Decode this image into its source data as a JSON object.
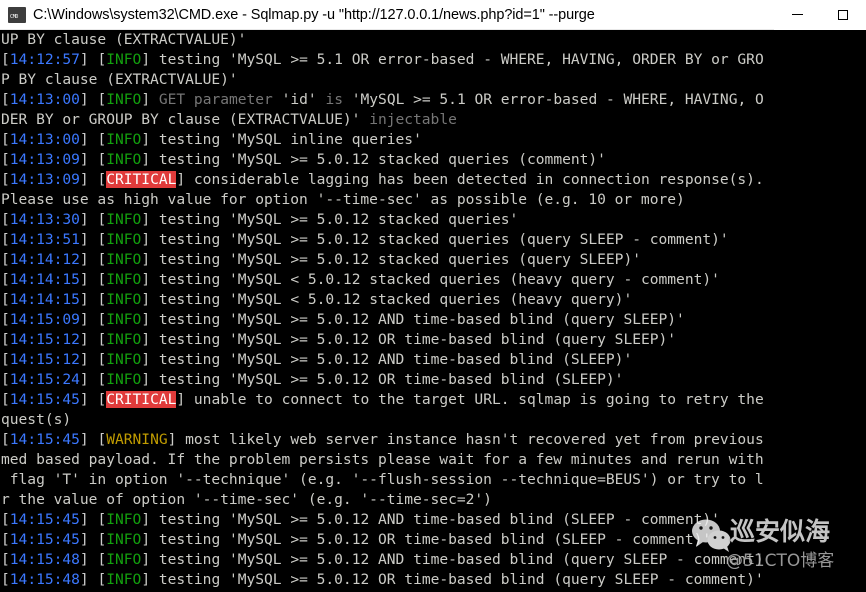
{
  "window": {
    "title": "C:\\Windows\\system32\\CMD.exe - Sqlmap.py  -u \"http://127.0.0.1/news.php?id=1\" --purge",
    "icon_label": "CMD",
    "minimize_label": "—",
    "maximize_label": "☐"
  },
  "colors": {
    "background": "#000000",
    "titlebar_background": "#ffffff",
    "default_text": "#c8d0d8",
    "timestamp": "#3b78ff",
    "info": "#13a10e",
    "warning": "#c19c00",
    "critical_background": "#e03b3b",
    "critical_text": "#ffffff",
    "dim_text": "#767676"
  },
  "console": {
    "lines": [
      {
        "segments": [
          {
            "text": "UP BY clause (EXTRACTVALUE)'",
            "style": "txt"
          }
        ]
      },
      {
        "segments": [
          {
            "text": "[",
            "style": "brk"
          },
          {
            "text": "14:12:57",
            "style": "time"
          },
          {
            "text": "] [",
            "style": "brk"
          },
          {
            "text": "INFO",
            "style": "info"
          },
          {
            "text": "] testing 'MySQL >= 5.1 OR error-based - WHERE, HAVING, ORDER BY or GRO",
            "style": "txt"
          }
        ]
      },
      {
        "segments": [
          {
            "text": "P BY clause (EXTRACTVALUE)'",
            "style": "txt"
          }
        ]
      },
      {
        "segments": [
          {
            "text": "[",
            "style": "brk"
          },
          {
            "text": "14:13:00",
            "style": "time"
          },
          {
            "text": "] [",
            "style": "brk"
          },
          {
            "text": "INFO",
            "style": "info"
          },
          {
            "text": "] ",
            "style": "txt"
          },
          {
            "text": "GET parameter",
            "style": "dim"
          },
          {
            "text": " 'id' ",
            "style": "txt"
          },
          {
            "text": "is",
            "style": "dim"
          },
          {
            "text": " 'MySQL >= 5.1 OR error-based - WHERE, HAVING, O",
            "style": "txt"
          }
        ]
      },
      {
        "segments": [
          {
            "text": "DER BY or GROUP BY clause (EXTRACTVALUE)' ",
            "style": "txt"
          },
          {
            "text": "injectable",
            "style": "dim"
          }
        ]
      },
      {
        "segments": [
          {
            "text": "[",
            "style": "brk"
          },
          {
            "text": "14:13:00",
            "style": "time"
          },
          {
            "text": "] [",
            "style": "brk"
          },
          {
            "text": "INFO",
            "style": "info"
          },
          {
            "text": "] testing 'MySQL inline queries'",
            "style": "txt"
          }
        ]
      },
      {
        "segments": [
          {
            "text": "[",
            "style": "brk"
          },
          {
            "text": "14:13:09",
            "style": "time"
          },
          {
            "text": "] [",
            "style": "brk"
          },
          {
            "text": "INFO",
            "style": "info"
          },
          {
            "text": "] testing 'MySQL >= 5.0.12 stacked queries (comment)'",
            "style": "txt"
          }
        ]
      },
      {
        "segments": [
          {
            "text": "[",
            "style": "brk"
          },
          {
            "text": "14:13:09",
            "style": "time"
          },
          {
            "text": "] [",
            "style": "brk"
          },
          {
            "text": "CRITICAL",
            "style": "crit"
          },
          {
            "text": "] considerable lagging has been detected in connection response(s).",
            "style": "txt"
          }
        ]
      },
      {
        "segments": [
          {
            "text": "Please use as high value for option '--time-sec' as possible (e.g. 10 or more)",
            "style": "txt"
          }
        ]
      },
      {
        "segments": [
          {
            "text": "[",
            "style": "brk"
          },
          {
            "text": "14:13:30",
            "style": "time"
          },
          {
            "text": "] [",
            "style": "brk"
          },
          {
            "text": "INFO",
            "style": "info"
          },
          {
            "text": "] testing 'MySQL >= 5.0.12 stacked queries'",
            "style": "txt"
          }
        ]
      },
      {
        "segments": [
          {
            "text": "[",
            "style": "brk"
          },
          {
            "text": "14:13:51",
            "style": "time"
          },
          {
            "text": "] [",
            "style": "brk"
          },
          {
            "text": "INFO",
            "style": "info"
          },
          {
            "text": "] testing 'MySQL >= 5.0.12 stacked queries (query SLEEP - comment)'",
            "style": "txt"
          }
        ]
      },
      {
        "segments": [
          {
            "text": "[",
            "style": "brk"
          },
          {
            "text": "14:14:12",
            "style": "time"
          },
          {
            "text": "] [",
            "style": "brk"
          },
          {
            "text": "INFO",
            "style": "info"
          },
          {
            "text": "] testing 'MySQL >= 5.0.12 stacked queries (query SLEEP)'",
            "style": "txt"
          }
        ]
      },
      {
        "segments": [
          {
            "text": "[",
            "style": "brk"
          },
          {
            "text": "14:14:15",
            "style": "time"
          },
          {
            "text": "] [",
            "style": "brk"
          },
          {
            "text": "INFO",
            "style": "info"
          },
          {
            "text": "] testing 'MySQL < 5.0.12 stacked queries (heavy query - comment)'",
            "style": "txt"
          }
        ]
      },
      {
        "segments": [
          {
            "text": "[",
            "style": "brk"
          },
          {
            "text": "14:14:15",
            "style": "time"
          },
          {
            "text": "] [",
            "style": "brk"
          },
          {
            "text": "INFO",
            "style": "info"
          },
          {
            "text": "] testing 'MySQL < 5.0.12 stacked queries (heavy query)'",
            "style": "txt"
          }
        ]
      },
      {
        "segments": [
          {
            "text": "[",
            "style": "brk"
          },
          {
            "text": "14:15:09",
            "style": "time"
          },
          {
            "text": "] [",
            "style": "brk"
          },
          {
            "text": "INFO",
            "style": "info"
          },
          {
            "text": "] testing 'MySQL >= 5.0.12 AND time-based blind (query SLEEP)'",
            "style": "txt"
          }
        ]
      },
      {
        "segments": [
          {
            "text": "[",
            "style": "brk"
          },
          {
            "text": "14:15:12",
            "style": "time"
          },
          {
            "text": "] [",
            "style": "brk"
          },
          {
            "text": "INFO",
            "style": "info"
          },
          {
            "text": "] testing 'MySQL >= 5.0.12 OR time-based blind (query SLEEP)'",
            "style": "txt"
          }
        ]
      },
      {
        "segments": [
          {
            "text": "[",
            "style": "brk"
          },
          {
            "text": "14:15:12",
            "style": "time"
          },
          {
            "text": "] [",
            "style": "brk"
          },
          {
            "text": "INFO",
            "style": "info"
          },
          {
            "text": "] testing 'MySQL >= 5.0.12 AND time-based blind (SLEEP)'",
            "style": "txt"
          }
        ]
      },
      {
        "segments": [
          {
            "text": "[",
            "style": "brk"
          },
          {
            "text": "14:15:24",
            "style": "time"
          },
          {
            "text": "] [",
            "style": "brk"
          },
          {
            "text": "INFO",
            "style": "info"
          },
          {
            "text": "] testing 'MySQL >= 5.0.12 OR time-based blind (SLEEP)'",
            "style": "txt"
          }
        ]
      },
      {
        "segments": [
          {
            "text": "[",
            "style": "brk"
          },
          {
            "text": "14:15:45",
            "style": "time"
          },
          {
            "text": "] [",
            "style": "brk"
          },
          {
            "text": "CRITICAL",
            "style": "crit"
          },
          {
            "text": "] unable to connect to the target URL. sqlmap is going to retry the",
            "style": "txt"
          }
        ]
      },
      {
        "segments": [
          {
            "text": "quest(s)",
            "style": "txt"
          }
        ]
      },
      {
        "segments": [
          {
            "text": "[",
            "style": "brk"
          },
          {
            "text": "14:15:45",
            "style": "time"
          },
          {
            "text": "] [",
            "style": "brk"
          },
          {
            "text": "WARNING",
            "style": "warn"
          },
          {
            "text": "] most likely web server instance hasn't recovered yet from previous",
            "style": "txt"
          }
        ]
      },
      {
        "segments": [
          {
            "text": "med based payload. If the problem persists please wait for a few minutes and rerun with",
            "style": "txt"
          }
        ]
      },
      {
        "segments": [
          {
            "text": " flag 'T' in option '--technique' (e.g. '--flush-session --technique=BEUS') or try to l",
            "style": "txt"
          }
        ]
      },
      {
        "segments": [
          {
            "text": "r the value of option '--time-sec' (e.g. '--time-sec=2')",
            "style": "txt"
          }
        ]
      },
      {
        "segments": [
          {
            "text": "[",
            "style": "brk"
          },
          {
            "text": "14:15:45",
            "style": "time"
          },
          {
            "text": "] [",
            "style": "brk"
          },
          {
            "text": "INFO",
            "style": "info"
          },
          {
            "text": "] testing 'MySQL >= 5.0.12 AND time-based blind (SLEEP - comment)'",
            "style": "txt"
          }
        ]
      },
      {
        "segments": [
          {
            "text": "[",
            "style": "brk"
          },
          {
            "text": "14:15:45",
            "style": "time"
          },
          {
            "text": "] [",
            "style": "brk"
          },
          {
            "text": "INFO",
            "style": "info"
          },
          {
            "text": "] testing 'MySQL >= 5.0.12 OR time-based blind (SLEEP - comment)'",
            "style": "txt"
          }
        ]
      },
      {
        "segments": [
          {
            "text": "[",
            "style": "brk"
          },
          {
            "text": "14:15:48",
            "style": "time"
          },
          {
            "text": "] [",
            "style": "brk"
          },
          {
            "text": "INFO",
            "style": "info"
          },
          {
            "text": "] testing 'MySQL >= 5.0.12 AND time-based blind (query SLEEP - comment)",
            "style": "txt"
          }
        ]
      },
      {
        "segments": [
          {
            "text": "[",
            "style": "brk"
          },
          {
            "text": "14:15:48",
            "style": "time"
          },
          {
            "text": "] [",
            "style": "brk"
          },
          {
            "text": "INFO",
            "style": "info"
          },
          {
            "text": "] testing 'MySQL >= 5.0.12 OR time-based blind (query SLEEP - comment)'",
            "style": "txt"
          }
        ]
      }
    ]
  },
  "watermark": {
    "title": "巡安似海",
    "subtitle": "@51CTO博客",
    "icon": "wechat-icon"
  }
}
